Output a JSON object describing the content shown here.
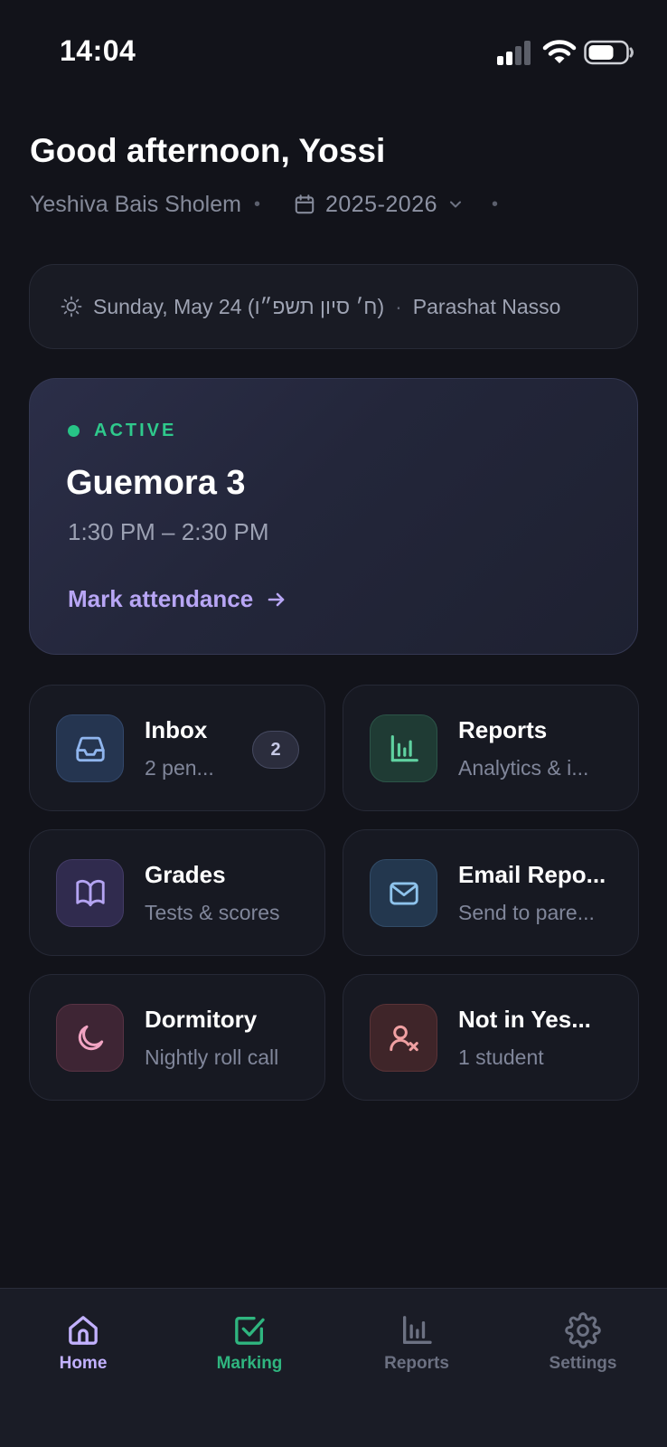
{
  "status_bar": {
    "time": "14:04",
    "icons": [
      "cellular-signal-icon",
      "wifi-icon",
      "battery-icon"
    ]
  },
  "header": {
    "greeting": "Good afternoon, Yossi",
    "school": "Yeshiva Bais Sholem",
    "school_year": "2025-2026"
  },
  "date_card": {
    "date": "Sunday, May 24 (ח׳ סיון תשפ״ו)",
    "parasha": "Parashat Nasso"
  },
  "active_session": {
    "status": "ACTIVE",
    "class_name": "Guemora 3",
    "time_range": "1:30 PM – 2:30 PM",
    "action_label": "Mark attendance",
    "status_color": "#27c486"
  },
  "tiles": [
    {
      "title": "Inbox",
      "subtitle": "2 pen...",
      "icon": "inbox-icon",
      "badge": "2"
    },
    {
      "title": "Reports",
      "subtitle": "Analytics & i...",
      "icon": "bar-chart-icon"
    },
    {
      "title": "Grades",
      "subtitle": "Tests & scores",
      "icon": "open-book-icon"
    },
    {
      "title": "Email Repo...",
      "subtitle": "Send to pare...",
      "icon": "envelope-icon"
    },
    {
      "title": "Dormitory",
      "subtitle": "Nightly roll call",
      "icon": "moon-icon"
    },
    {
      "title": "Not in Yes...",
      "subtitle": "1 student",
      "icon": "user-x-icon"
    }
  ],
  "bottom_nav": {
    "items": [
      {
        "label": "Home",
        "icon": "home-icon",
        "color": "#c2b1ff",
        "active": true
      },
      {
        "label": "Marking",
        "icon": "checkbox-icon",
        "color": "#2fb57f"
      },
      {
        "label": "Reports",
        "icon": "bar-chart-icon",
        "color": "#6c7182"
      },
      {
        "label": "Settings",
        "icon": "gear-icon",
        "color": "#6c7182"
      }
    ]
  },
  "colors": {
    "background": "#12131a",
    "accent_purple": "#b8a6f5",
    "active_green": "#27c486"
  }
}
